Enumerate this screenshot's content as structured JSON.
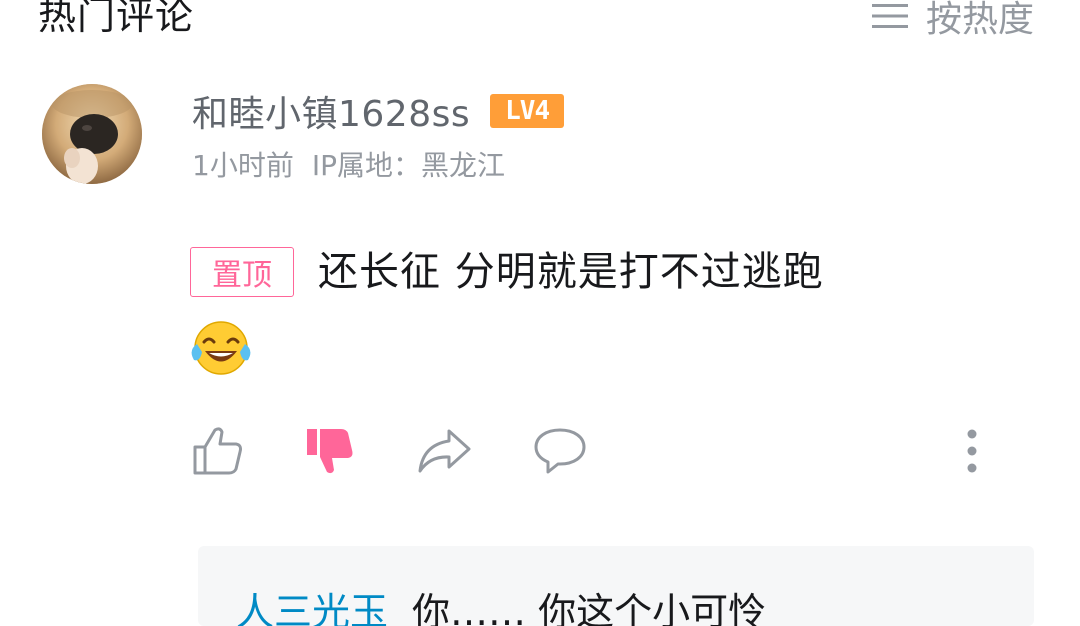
{
  "header": {
    "title": "热门评论",
    "sort_label": "按热度"
  },
  "comment": {
    "username": "和睦小镇1628ss",
    "level": "LV4",
    "time": "1小时前",
    "ip_location": "IP属地：黑龙江",
    "pinned_tag": "置顶",
    "text": "还长征 分明就是打不过逃跑",
    "emoji": "tears-of-joy-emoji",
    "thumbs_down_active": true,
    "colors": {
      "pinned": "#ff6699",
      "level_badge": "#ff9e38",
      "dislike_active": "#ff6699"
    }
  },
  "reply_preview": {
    "author": "人三光玉",
    "text": "你…… 你这个小可怜"
  }
}
